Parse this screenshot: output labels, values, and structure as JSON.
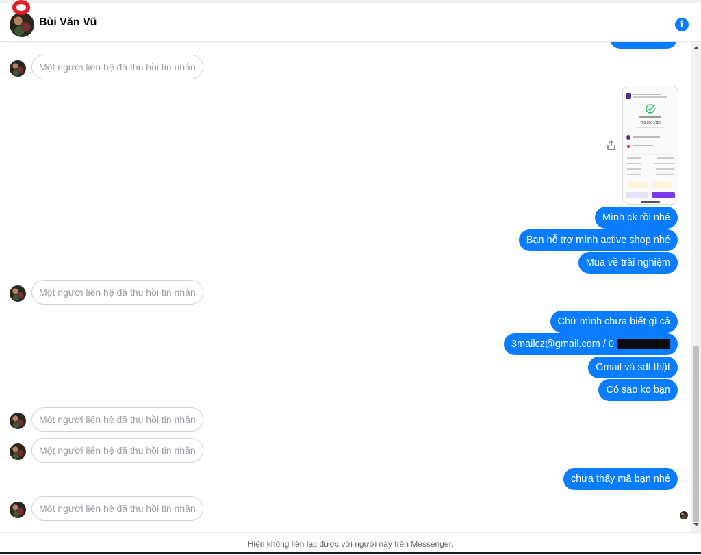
{
  "header": {
    "contact_name": "Bùi Văn Vũ",
    "info_icon": "info-icon",
    "info_glyph": "i"
  },
  "messages": {
    "unsent_text": "Một người liên hệ đã thu hồi tin nhắn",
    "out_1": "Mình ck rồi nhé",
    "out_2": "Bạn hỗ trợ mình active shop nhé",
    "out_3": "Mua về trải nghiệm",
    "out_4": "Chứ mình chưa biết gì cả",
    "out_5_email": "3mailcz@gmail.com / 0",
    "out_6": "Gmail và sdt thật",
    "out_7": "Có sao ko bạn",
    "out_8": "chưa thấy mã bạn nhé"
  },
  "receipt": {
    "amount": "700,000 VND",
    "success_color": "#22c55e",
    "button_color": "#7c3aed"
  },
  "footer": {
    "notice": "Hiện không liên lạc được với người này trên Messenger."
  },
  "colors": {
    "bubble": "#0a7cff",
    "record_badge": "#e41e26"
  }
}
